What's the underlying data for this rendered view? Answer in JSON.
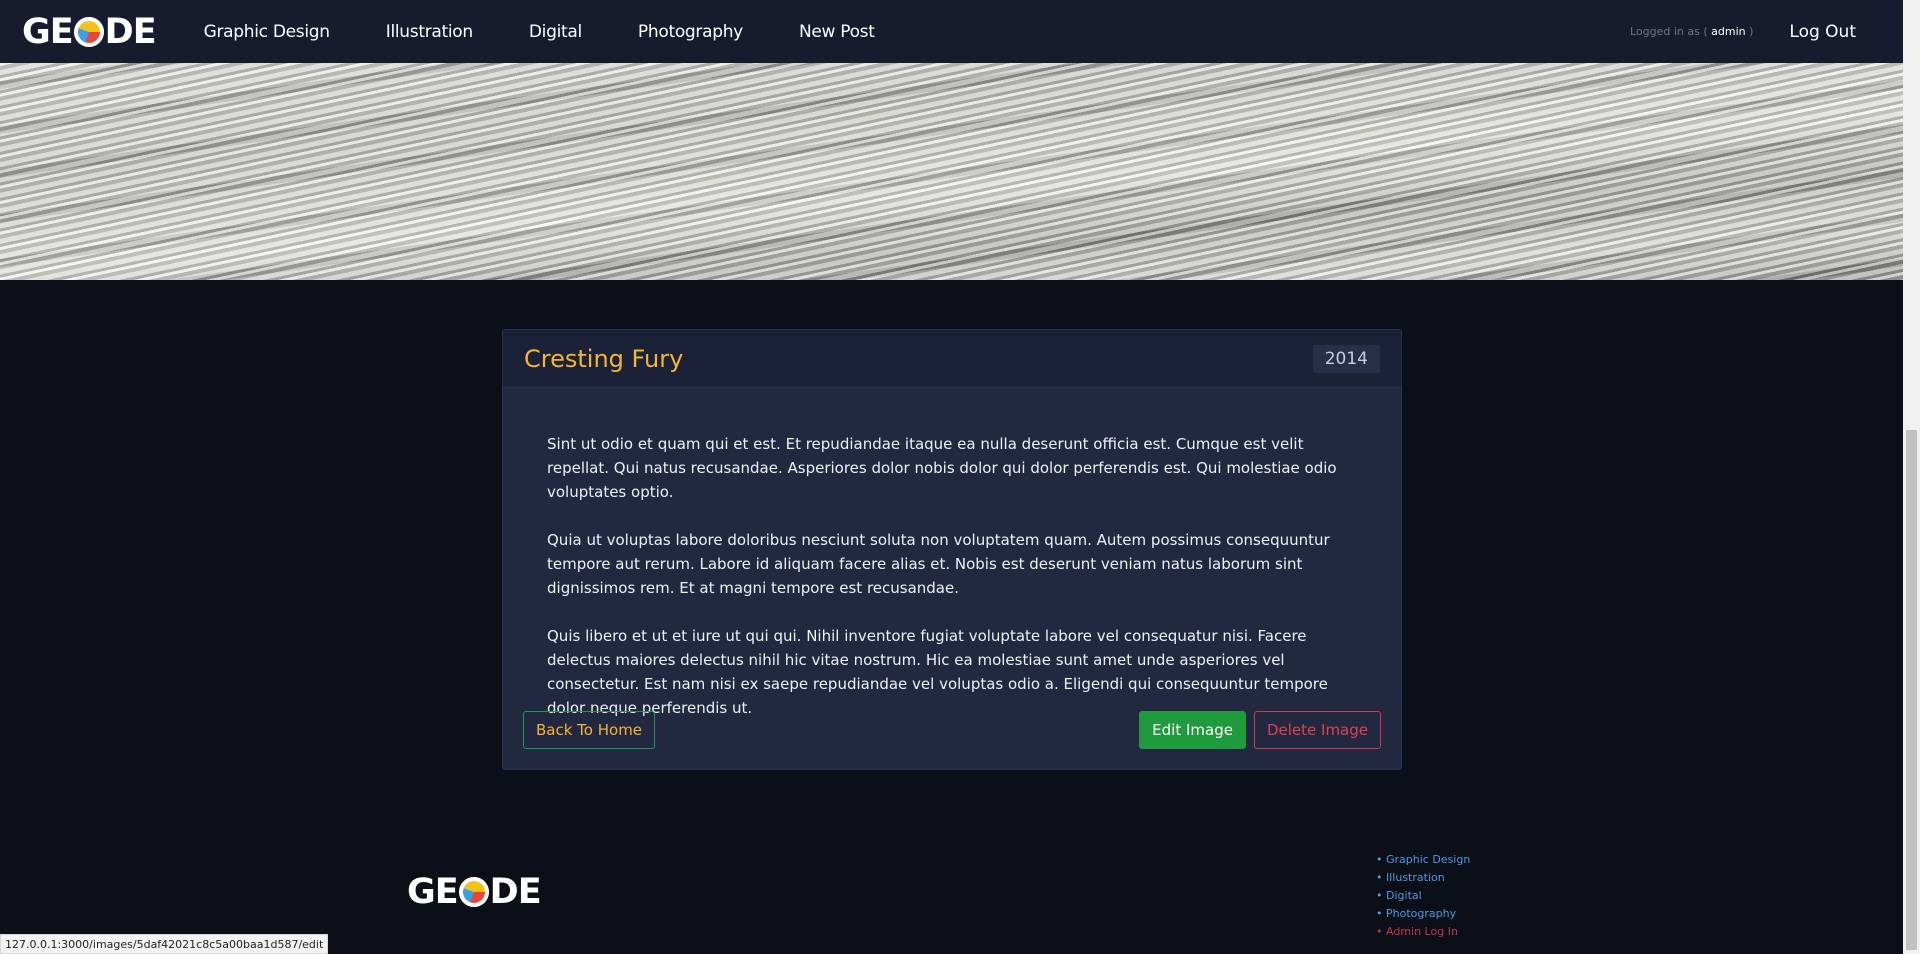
{
  "navbar": {
    "logo_left": "GE",
    "logo_right": "DE",
    "links": [
      "Graphic Design",
      "Illustration",
      "Digital",
      "Photography",
      "New Post"
    ],
    "logged_in_prefix": "Logged in as (",
    "username": "admin",
    "logged_in_suffix": ")",
    "logout": "Log Out"
  },
  "post": {
    "title": "Cresting Fury",
    "year": "2014",
    "paragraphs": [
      "Sint ut odio et quam qui et est. Et repudiandae itaque ea nulla deserunt officia est. Cumque est velit repellat. Qui natus recusandae. Asperiores dolor nobis dolor qui dolor perferendis est. Qui molestiae odio voluptates optio.",
      "Quia ut voluptas labore doloribus nesciunt soluta non voluptatem quam. Autem possimus consequuntur tempore aut rerum. Labore id aliquam facere alias et. Nobis est deserunt veniam natus laborum sint dignissimos rem. Et at magni tempore est recusandae.",
      "Quis libero et ut et iure ut qui qui. Nihil inventore fugiat voluptate labore vel consequatur nisi. Facere delectus maiores delectus nihil hic vitae nostrum. Hic ea molestiae sunt amet unde asperiores vel consectetur. Est nam nisi ex saepe repudiandae vel voluptas odio a. Eligendi qui consequuntur tempore dolor neque perferendis ut."
    ],
    "back_label": "Back To Home",
    "edit_label": "Edit Image",
    "delete_label": "Delete Image"
  },
  "footer": {
    "logo_left": "GE",
    "logo_right": "DE",
    "links": [
      "Graphic Design",
      "Illustration",
      "Digital",
      "Photography"
    ],
    "admin_link": "Admin Log In"
  },
  "status_url": "127.0.0.1:3000/images/5daf42021c8c5a00baa1d587/edit",
  "colors": {
    "title": "#f5b52e",
    "card_bg": "#212840",
    "nav_bg": "#161c2e",
    "page_bg": "#0b0f17",
    "edit_green": "#1f9a3c",
    "delete_red": "#e0424f",
    "link_blue": "#4d9ae6"
  }
}
